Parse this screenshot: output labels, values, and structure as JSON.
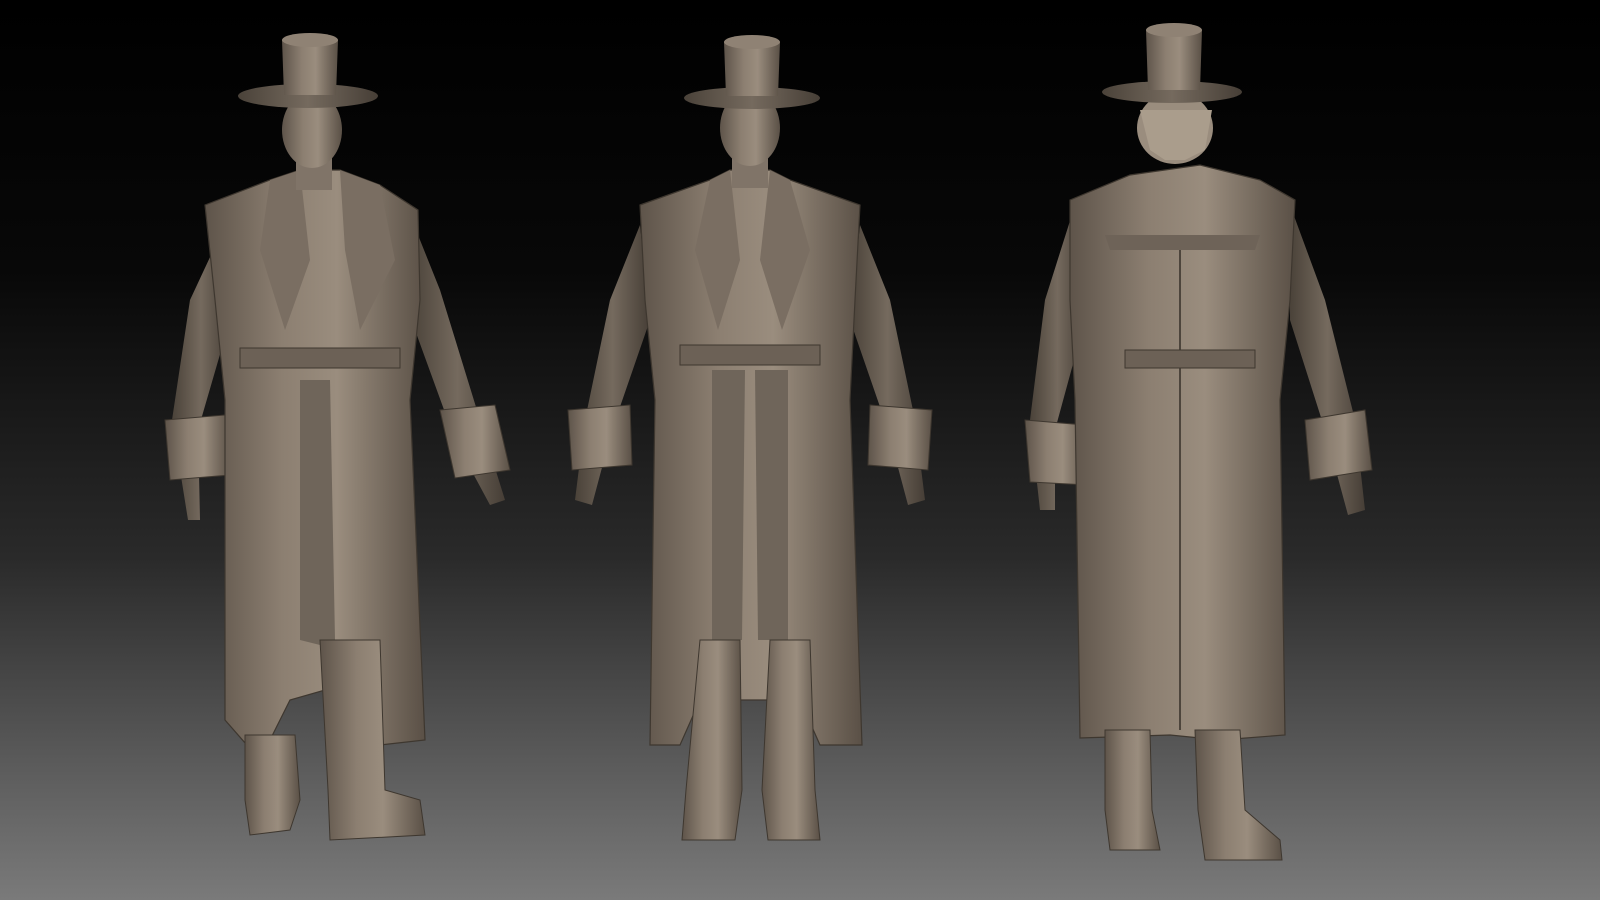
{
  "scene": {
    "background": {
      "top": "#000000",
      "bottom": "#7a7a7a"
    },
    "material_color": "#8c7f71",
    "figures": [
      {
        "view": "three-quarter"
      },
      {
        "view": "front"
      },
      {
        "view": "back"
      }
    ]
  }
}
